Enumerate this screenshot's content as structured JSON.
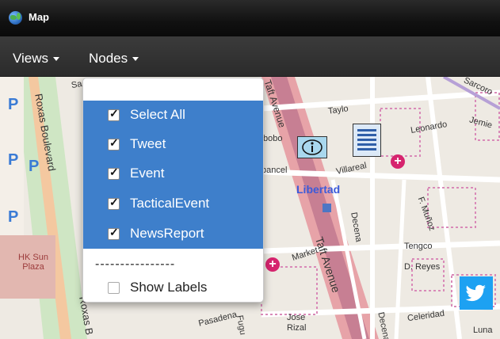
{
  "app": {
    "title": "Map"
  },
  "menubar": {
    "views_label": "Views",
    "nodes_label": "Nodes"
  },
  "nodes_menu": {
    "items": [
      {
        "label": "Select All",
        "checked": true
      },
      {
        "label": "Tweet",
        "checked": true
      },
      {
        "label": "Event",
        "checked": true
      },
      {
        "label": "TacticalEvent",
        "checked": true
      },
      {
        "label": "NewsReport",
        "checked": true
      }
    ],
    "separator": "----------------",
    "show_labels": {
      "label": "Show Labels",
      "checked": false
    }
  },
  "map": {
    "labels": {
      "roxas_blvd": "Roxas Boulevard",
      "taft_avenue_top": "Taft Avenue",
      "taft_avenue": "Taft Avenue",
      "taylo": "Taylo",
      "leonardo": "Leonardo",
      "jemie": "Jemie",
      "libertad": "Libertad",
      "villareal": "Villareal",
      "decena": "Decena",
      "decena2": "Decena",
      "f_munoz": "F. Muñoz",
      "tengco": "Tengco",
      "d_reyes": "D. Reyes",
      "market": "Market",
      "pasadena": "Pasadena",
      "jose_rizal": "Jose Rizal",
      "celeridad": "Celeridad",
      "luna": "Luna",
      "hk_sun_plaza": "HK Sun Plaza",
      "roxas_b": "Roxas B",
      "bobo": "bobo",
      "pancel": "pancel",
      "sarcoro": "Sarcoro",
      "sa": "Sa",
      "fugu": "Fugu"
    },
    "parking_symbol": "P"
  },
  "colors": {
    "dropdown_highlight": "#3e7fcb",
    "libertad_label": "#3b5bdb",
    "twitter_blue": "#1da1f2",
    "hospital_magenta": "#d6246e"
  }
}
